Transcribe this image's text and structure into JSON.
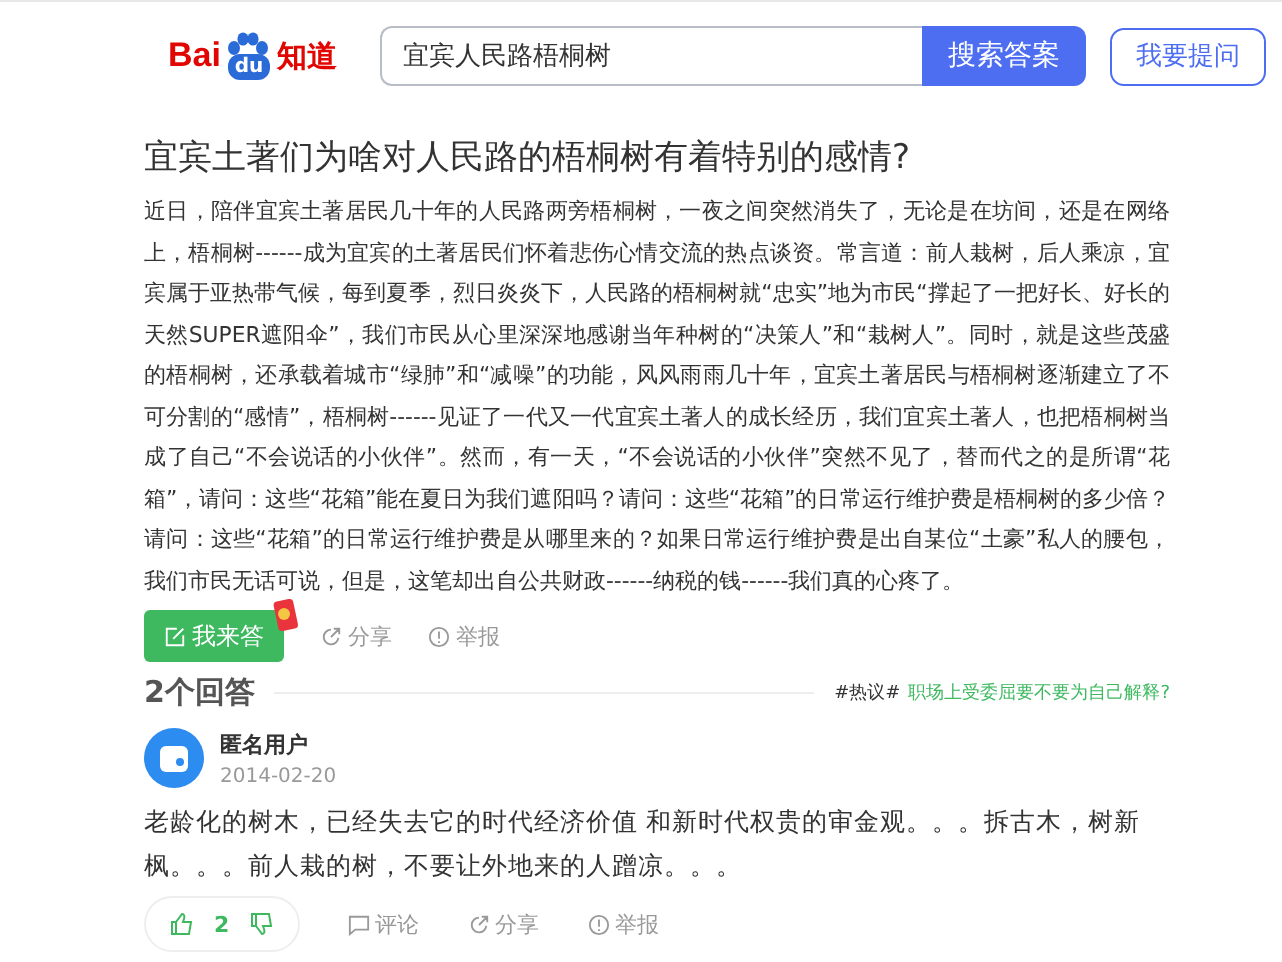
{
  "logo": {
    "left": "Bai",
    "paw": "du",
    "right": "知道"
  },
  "search": {
    "value": "宜宾人民路梧桐树",
    "button": "搜索答案"
  },
  "ask_button": "我要提问",
  "question": {
    "title": "宜宾土著们为啥对人民路的梧桐树有着特别的感情?",
    "body": "近日，陪伴宜宾土著居民几十年的人民路两旁梧桐树，一夜之间突然消失了，无论是在坊间，还是在网络上，梧桐树------成为宜宾的土著居民们怀着悲伤心情交流的热点谈资。常言道：前人栽树，后人乘凉，宜宾属于亚热带气候，每到夏季，烈日炎炎下，人民路的梧桐树就“忠实”地为市民“撑起了一把好长、好长的天然SUPER遮阳伞”，我们市民从心里深深地感谢当年种树的“决策人”和“栽树人”。同时，就是这些茂盛的梧桐树，还承载着城市“绿肺”和“减噪”的功能，风风雨雨几十年，宜宾土著居民与梧桐树逐渐建立了不可分割的“感情”，梧桐树------见证了一代又一代宜宾土著人的成长经历，我们宜宾土著人，也把梧桐树当成了自己“不会说话的小伙伴”。然而，有一天，“不会说话的小伙伴”突然不见了，替而代之的是所谓“花箱”，请问：这些“花箱”能在夏日为我们遮阳吗？请问：这些“花箱”的日常运行维护费是梧桐树的多少倍？请问：这些“花箱”的日常运行维护费是从哪里来的？如果日常运行维护费是出自某位“土豪”私人的腰包，我们市民无话可说，但是，这笔却出自公共财政------纳税的钱------我们真的心疼了。",
    "answer_button": "我来答",
    "share": "分享",
    "report": "举报"
  },
  "answers_header": {
    "count": "2个回答",
    "hot_tag": "#热议#",
    "hot_link": "职场上受委屈要不要为自己解释?"
  },
  "answers": [
    {
      "author": "匿名用户",
      "date": "2014-02-20",
      "text": "老龄化的树木，已经失去它的时代经济价值 和新时代权贵的审金观。。。拆古木，树新枫。。。前人栽的树，不要让外地来的人蹭凉。。。",
      "likes": "2",
      "comment": "评论",
      "share": "分享",
      "report": "举报"
    }
  ]
}
